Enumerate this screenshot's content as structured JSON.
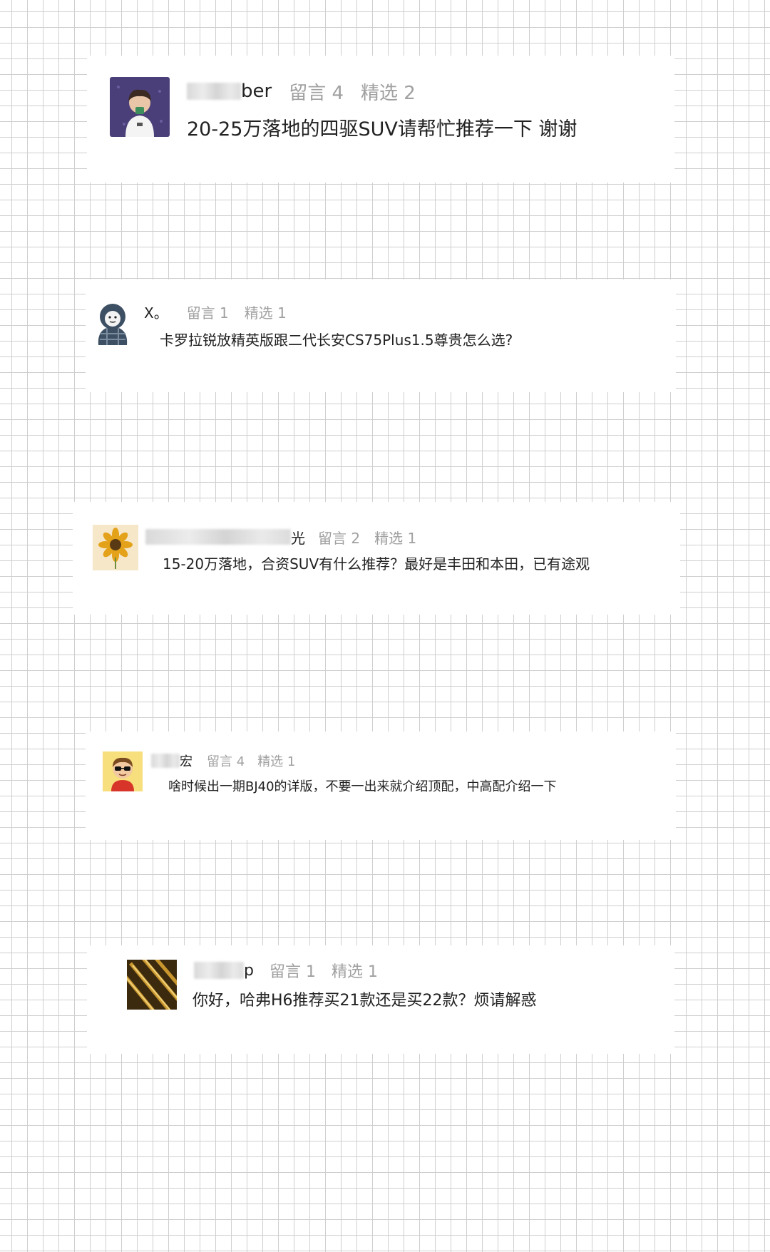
{
  "posts": [
    {
      "author_visible": "ber",
      "avatar": "young-man-avatar-icon",
      "comments": "留言 4",
      "featured": "精选 2",
      "question": "20-25万落地的四驱SUV请帮忙推荐一下 谢谢"
    },
    {
      "author_visible": "X。",
      "avatar": "cartoon-hooded-avatar-icon",
      "comments": "留言 1",
      "featured": "精选 1",
      "question": "卡罗拉锐放精英版跟二代长安CS75Plus1.5尊贵怎么选?"
    },
    {
      "author_visible": "光",
      "avatar": "sunflower-avatar-icon",
      "comments": "留言 2",
      "featured": "精选 1",
      "question": "15-20万落地，合资SUV有什么推荐？最好是丰田和本田，已有途观"
    },
    {
      "author_visible": "宏",
      "avatar": "sunglasses-cartoon-avatar-icon",
      "comments": "留言 4",
      "featured": "精选 1",
      "question": "啥时候出一期BJ40的详版，不要一出来就介绍顶配，中高配介绍一下"
    },
    {
      "author_visible": "p",
      "avatar": "gold-texture-avatar-icon",
      "comments": "留言 1",
      "featured": "精选 1",
      "question": "你好，哈弗H6推荐买21款还是买22款？烦请解惑"
    }
  ]
}
